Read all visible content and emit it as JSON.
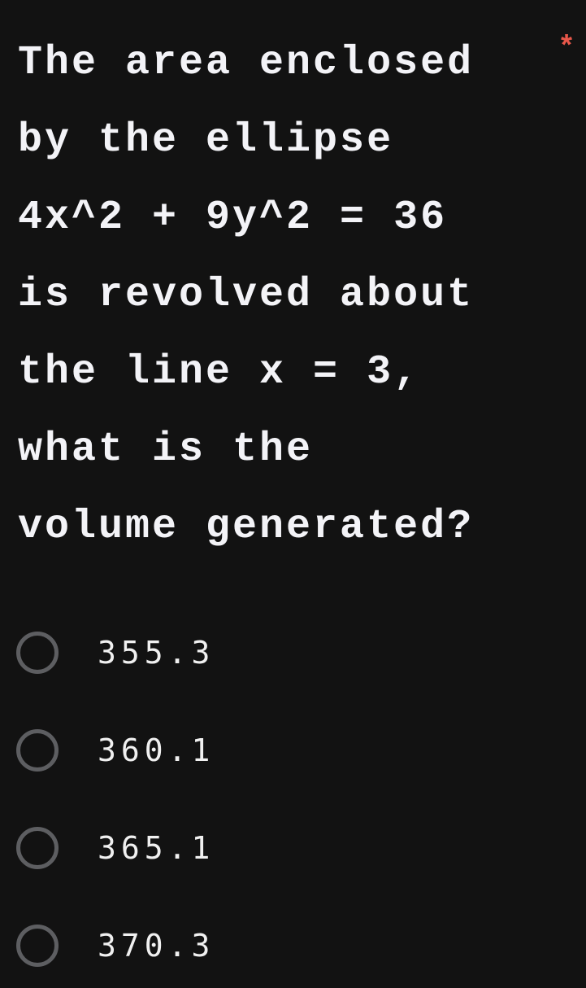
{
  "question": {
    "lines": [
      "The area enclosed",
      "by the ellipse",
      "4x^2 + 9y^2 = 36",
      "is revolved about",
      "the line x = 3,",
      "what is the",
      "volume generated?"
    ],
    "required_marker": "*",
    "required_color": "#e8574a"
  },
  "options": [
    {
      "label": "355.3",
      "selected": false
    },
    {
      "label": "360.1",
      "selected": false
    },
    {
      "label": "365.1",
      "selected": false
    },
    {
      "label": "370.3",
      "selected": false
    }
  ]
}
